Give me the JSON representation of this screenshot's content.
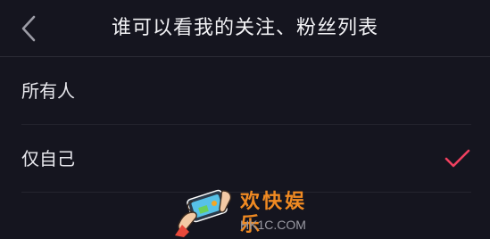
{
  "header": {
    "title": "谁可以看我的关注、粉丝列表",
    "back_icon": "chevron-left-icon"
  },
  "options": [
    {
      "label": "所有人",
      "selected": false
    },
    {
      "label": "仅自己",
      "selected": true
    }
  ],
  "colors": {
    "background": "#15151f",
    "text": "#ecedf1",
    "divider": "#24242e",
    "check_accent": "#f0405f",
    "watermark_orange": "#f08a22"
  },
  "watermark": {
    "title": "欢快娱乐",
    "domain": "HK1C.COM",
    "logo_icon": "hands-holding-phone-icon"
  }
}
